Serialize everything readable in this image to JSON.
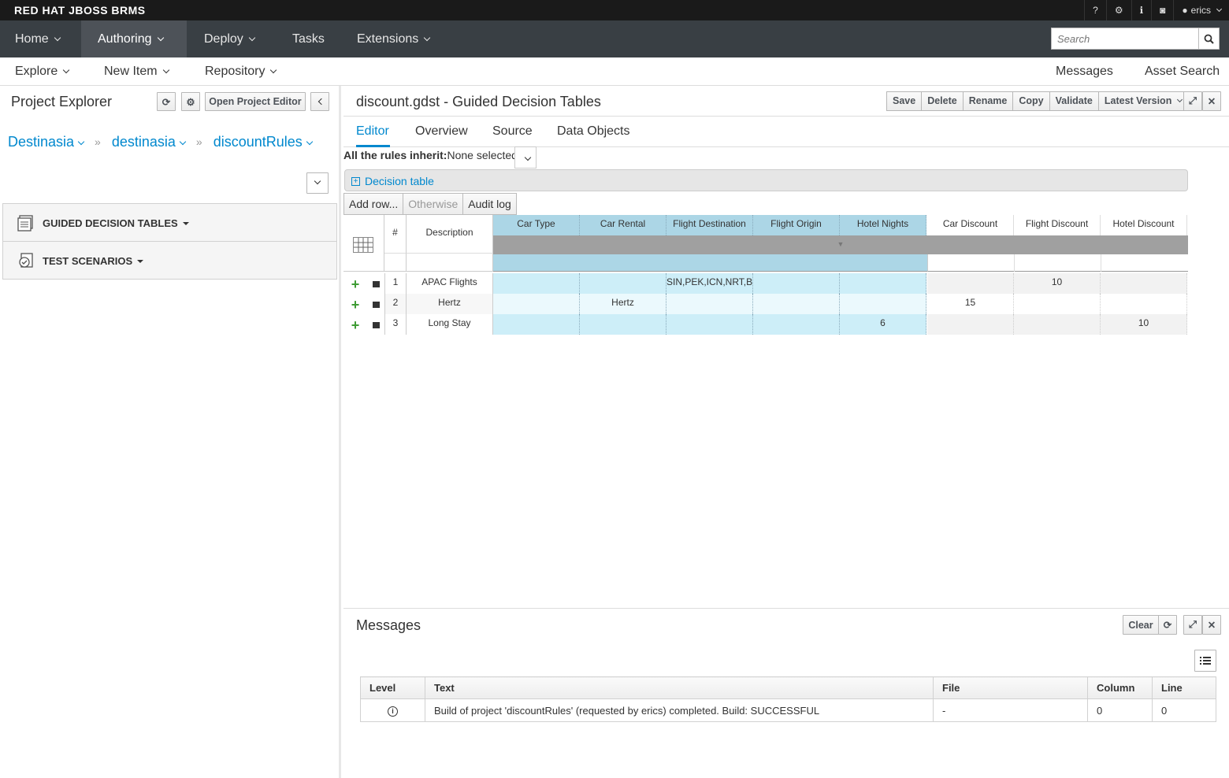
{
  "brand": "RED HAT JBOSS BRMS",
  "top_icons": {
    "help": "?",
    "settings": "⚙",
    "info": "ℹ",
    "camera": "◙",
    "user": "erics"
  },
  "nav": {
    "home": "Home",
    "authoring": "Authoring",
    "deploy": "Deploy",
    "tasks": "Tasks",
    "extensions": "Extensions",
    "search_placeholder": "Search"
  },
  "subnav": {
    "explore": "Explore",
    "new_item": "New Item",
    "repository": "Repository",
    "messages": "Messages",
    "asset_search": "Asset Search"
  },
  "explorer": {
    "title": "Project Explorer",
    "open_project_editor": "Open Project Editor",
    "breadcrumbs": [
      "Destinasia",
      "destinasia",
      "discountRules"
    ],
    "sections": [
      "GUIDED DECISION TABLES",
      "TEST SCENARIOS"
    ]
  },
  "editor": {
    "title": "discount.gdst - Guided Decision Tables",
    "toolbar": [
      "Save",
      "Delete",
      "Rename",
      "Copy",
      "Validate",
      "Latest Version"
    ],
    "tabs": [
      "Editor",
      "Overview",
      "Source",
      "Data Objects"
    ],
    "inherit_label": "All the rules inherit:",
    "inherit_value": "None selected",
    "decision_table_label": "Decision table",
    "grid_buttons": [
      "Add row...",
      "Otherwise",
      "Audit log"
    ],
    "columns": {
      "num": "#",
      "description": "Description",
      "conditions": [
        "Car Type",
        "Car Rental",
        "Flight Destination",
        "Flight Origin",
        "Hotel Nights"
      ],
      "actions": [
        "Car Discount",
        "Flight Discount",
        "Hotel Discount"
      ]
    },
    "rows": [
      {
        "num": "1",
        "description": "APAC Flights",
        "cells": [
          "",
          "",
          "SIN,PEK,ICN,NRT,BO",
          "",
          "",
          "",
          "10",
          ""
        ]
      },
      {
        "num": "2",
        "description": "Hertz",
        "cells": [
          "",
          "Hertz",
          "",
          "",
          "",
          "15",
          "",
          ""
        ]
      },
      {
        "num": "3",
        "description": "Long Stay",
        "cells": [
          "",
          "",
          "",
          "",
          "6",
          "",
          "",
          "10"
        ]
      }
    ]
  },
  "messages": {
    "title": "Messages",
    "clear": "Clear",
    "headers": [
      "Level",
      "Text",
      "File",
      "Column",
      "Line"
    ],
    "rows": [
      {
        "text": "Build of project 'discountRules' (requested by erics) completed. Build: SUCCESSFUL",
        "file": "-",
        "column": "0",
        "line": "0"
      }
    ]
  }
}
